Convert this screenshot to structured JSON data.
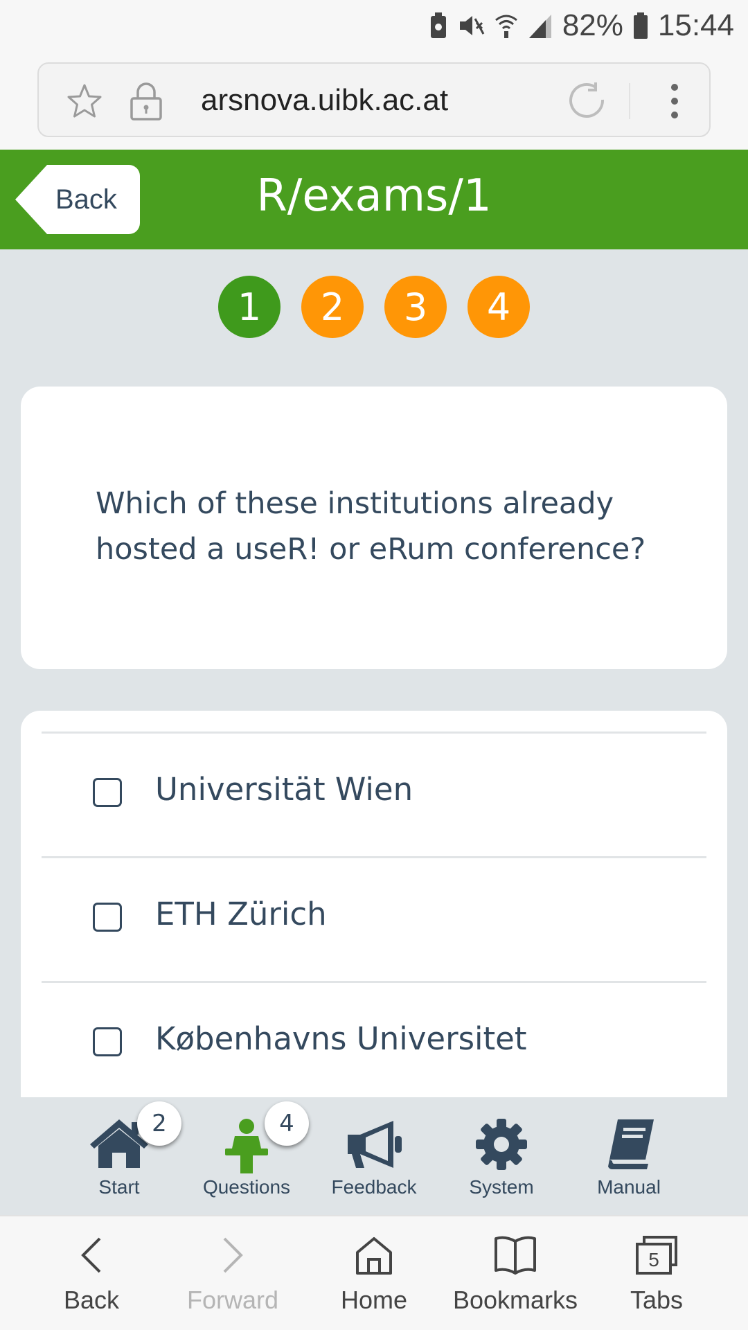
{
  "status_bar": {
    "battery_percent": "82%",
    "time": "15:44",
    "icons": [
      "battery-saver-icon",
      "mute-icon",
      "wifi-icon",
      "signal-icon",
      "battery-icon"
    ]
  },
  "browser": {
    "url": "arsnova.uibk.ac.at",
    "icons": [
      "star-icon",
      "lock-icon",
      "reload-icon",
      "more-menu-icon"
    ]
  },
  "header": {
    "back_label": "Back",
    "title": "R/exams/1",
    "color": "#4a9e1f"
  },
  "pager": {
    "items": [
      {
        "label": "1",
        "state": "active",
        "color": "#3f9a1c"
      },
      {
        "label": "2",
        "state": "pending",
        "color": "#ff9606"
      },
      {
        "label": "3",
        "state": "pending",
        "color": "#ff9606"
      },
      {
        "label": "4",
        "state": "pending",
        "color": "#ff9606"
      }
    ]
  },
  "question": {
    "text": "Which of these institutions already hosted a useR! or eRum conference?"
  },
  "answers": [
    {
      "label": "Universität Wien",
      "checked": false
    },
    {
      "label": "ETH Zürich",
      "checked": false
    },
    {
      "label": "Københavns Universitet",
      "checked": false
    }
  ],
  "app_nav": {
    "items": [
      {
        "label": "Start",
        "icon": "home-icon",
        "badge": "2"
      },
      {
        "label": "Questions",
        "icon": "lecturer-icon",
        "badge": "4",
        "active": true
      },
      {
        "label": "Feedback",
        "icon": "megaphone-icon"
      },
      {
        "label": "System",
        "icon": "gear-icon"
      },
      {
        "label": "Manual",
        "icon": "book-icon"
      }
    ]
  },
  "browser_nav": {
    "items": [
      {
        "label": "Back",
        "icon": "chevron-left-icon"
      },
      {
        "label": "Forward",
        "icon": "chevron-right-icon",
        "disabled": true
      },
      {
        "label": "Home",
        "icon": "home-outline-icon"
      },
      {
        "label": "Bookmarks",
        "icon": "bookmarks-icon"
      },
      {
        "label": "Tabs",
        "icon": "tabs-icon",
        "count": "5"
      }
    ]
  }
}
